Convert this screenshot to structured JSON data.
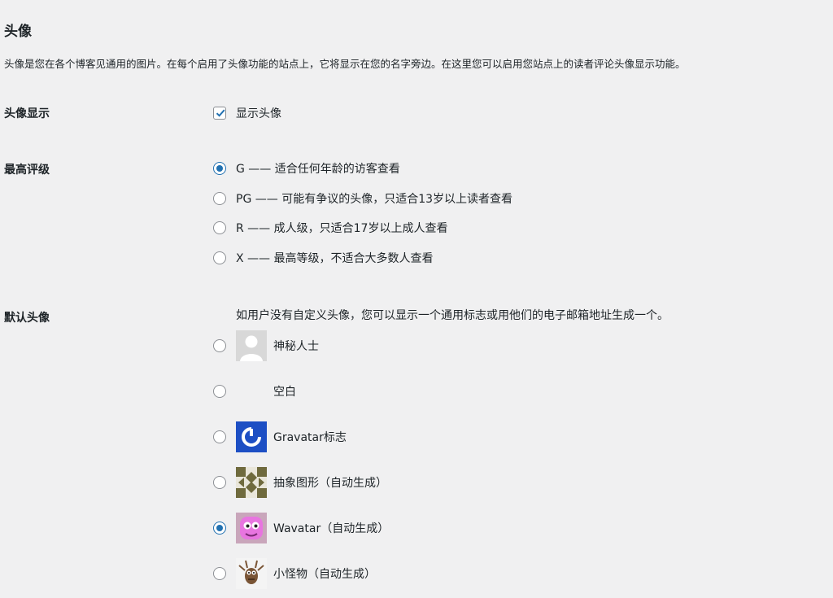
{
  "section": {
    "title": "头像",
    "description": "头像是您在各个博客见通用的图片。在每个启用了头像功能的站点上，它将显示在您的名字旁边。在这里您可以启用您站点上的读者评论头像显示功能。"
  },
  "avatar_display": {
    "label": "头像显示",
    "checkbox_label": "显示头像",
    "checked": true
  },
  "max_rating": {
    "label": "最高评级",
    "selected": "G",
    "options": [
      {
        "value": "G",
        "label": "G —— 适合任何年龄的访客查看"
      },
      {
        "value": "PG",
        "label": "PG —— 可能有争议的头像，只适合13岁以上读者查看"
      },
      {
        "value": "R",
        "label": "R —— 成人级，只适合17岁以上成人查看"
      },
      {
        "value": "X",
        "label": "X —— 最高等级，不适合大多数人查看"
      }
    ]
  },
  "default_avatar": {
    "label": "默认头像",
    "description": "如用户没有自定义头像，您可以显示一个通用标志或用他们的电子邮箱地址生成一个。",
    "selected": "wavatar",
    "options": [
      {
        "value": "mystery",
        "label": "神秘人士",
        "icon": "mystery-person-icon"
      },
      {
        "value": "blank",
        "label": "空白",
        "icon": "blank-icon"
      },
      {
        "value": "gravatar",
        "label": "Gravatar标志",
        "icon": "gravatar-logo-icon"
      },
      {
        "value": "identicon",
        "label": "抽象图形（自动生成）",
        "icon": "identicon-icon"
      },
      {
        "value": "wavatar",
        "label": "Wavatar（自动生成）",
        "icon": "wavatar-icon"
      },
      {
        "value": "monsterid",
        "label": "小怪物（自动生成）",
        "icon": "monster-icon"
      }
    ]
  },
  "colors": {
    "background": "#f0f0f1",
    "text": "#1d2327",
    "accent": "#2271b1",
    "border": "#8c8f94"
  }
}
